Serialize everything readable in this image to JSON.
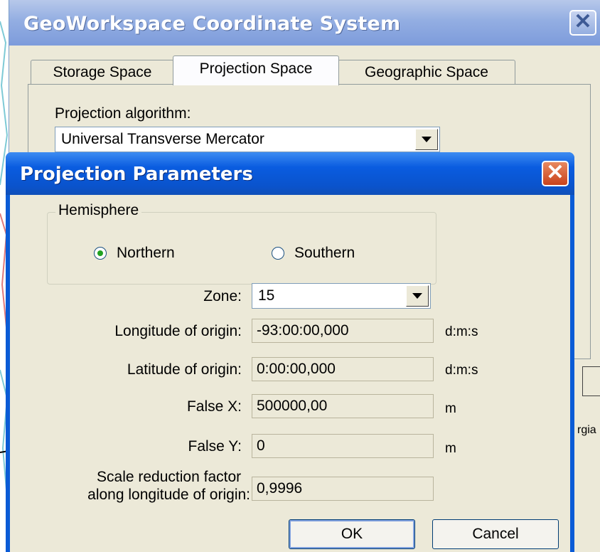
{
  "outer_dialog": {
    "title": "GeoWorkspace Coordinate System",
    "close_glyph": "✕",
    "tabs": [
      {
        "label": "Storage Space"
      },
      {
        "label": "Projection Space"
      },
      {
        "label": "Geographic Space"
      }
    ],
    "projection_algorithm_label": "Projection algorithm:",
    "projection_algorithm_value": "Universal Transverse Mercator",
    "map_fragment_text": "rgia"
  },
  "projection_dialog": {
    "title": "Projection Parameters",
    "close_glyph": "✕",
    "hemisphere": {
      "legend": "Hemisphere",
      "northern_label": "Northern",
      "southern_label": "Southern",
      "selected": "Northern"
    },
    "zone": {
      "label": "Zone:",
      "value": "15"
    },
    "fields": [
      {
        "label": "Longitude of origin:",
        "value": "-93:00:00,000",
        "unit": "d:m:s"
      },
      {
        "label": "Latitude of origin:",
        "value": "0:00:00,000",
        "unit": "d:m:s"
      },
      {
        "label": "False X:",
        "value": "500000,00",
        "unit": "m"
      },
      {
        "label": "False Y:",
        "value": "0",
        "unit": "m"
      }
    ],
    "scale": {
      "label_line1": "Scale reduction factor",
      "label_line2": "along longitude of origin:",
      "value": "0,9996"
    },
    "ok_label": "OK",
    "cancel_label": "Cancel"
  },
  "colors": {
    "outer_title": "#93aee2",
    "inner_title": "#0a5ce0",
    "dialog_face": "#ece9d8",
    "close_red": "#c9421c"
  },
  "icons": [
    "close-icon",
    "chevron-down-icon",
    "radio-selected-icon",
    "radio-empty-icon"
  ]
}
